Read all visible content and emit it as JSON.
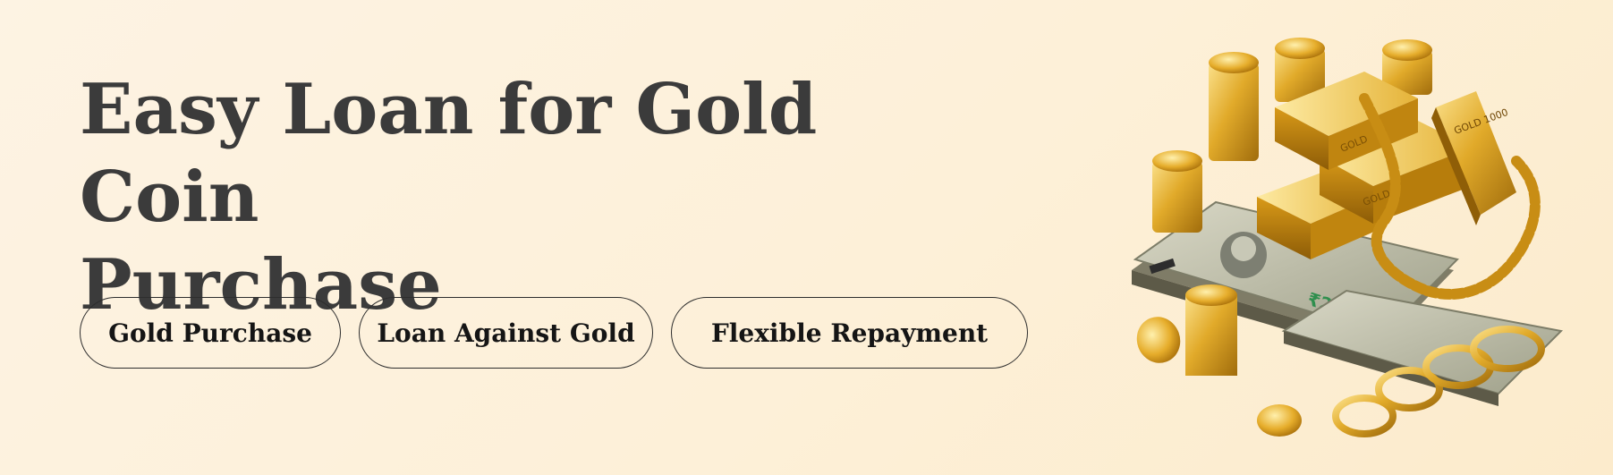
{
  "hero": {
    "title_line1": "Easy Loan for Gold Coin",
    "title_line2": "Purchase",
    "chips": [
      "Gold Purchase",
      "Loan Against Gold",
      "Flexible Repayment"
    ]
  },
  "illustration": {
    "icon": "gold-and-cash-illustration",
    "bar_labels": [
      "GOLD",
      "GOLD",
      "GOLD 1000"
    ],
    "note_label": "₹2000",
    "colors": {
      "gold": "#d9a21f",
      "gold_light": "#f6d36a",
      "gold_dark": "#9c6b0b",
      "note": "#b9b9a4",
      "note_green": "#2f8f4e"
    }
  },
  "colors": {
    "background": "#fdf1dc",
    "title": "#3b3b3b",
    "chip_border": "#2d2d2d",
    "chip_text": "#151515"
  }
}
